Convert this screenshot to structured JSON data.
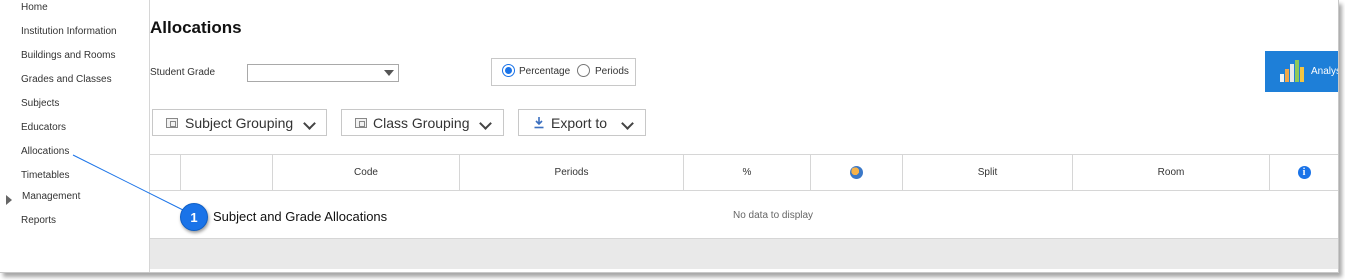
{
  "sidebar": {
    "items": [
      {
        "label": "Home"
      },
      {
        "label": "Institution Information"
      },
      {
        "label": "Buildings and Rooms"
      },
      {
        "label": "Grades and Classes"
      },
      {
        "label": "Subjects"
      },
      {
        "label": "Educators"
      },
      {
        "label": "Allocations"
      },
      {
        "label": "Timetables"
      },
      {
        "label": "Management"
      },
      {
        "label": "Reports"
      }
    ]
  },
  "page": {
    "title": "Allocations",
    "student_grade_label": "Student Grade",
    "student_grade_value": ""
  },
  "display_mode": {
    "options": [
      "Percentage",
      "Periods"
    ],
    "selected": "Percentage"
  },
  "analyse_button": {
    "label": "Analys"
  },
  "toolbar": {
    "subject_grouping": "Subject Grouping",
    "class_grouping": "Class Grouping",
    "export": "Export to"
  },
  "table": {
    "columns": [
      "",
      "",
      "Code",
      "Periods",
      "%",
      "",
      "Split",
      "Room",
      ""
    ],
    "empty_message": "No data to display"
  },
  "callout": {
    "number": "1",
    "text": "Subject and Grade Allocations"
  },
  "colors": {
    "accent": "#1a73e8",
    "analyse_bg": "#1e7fd8",
    "footer_bg": "#e9e9e9"
  }
}
